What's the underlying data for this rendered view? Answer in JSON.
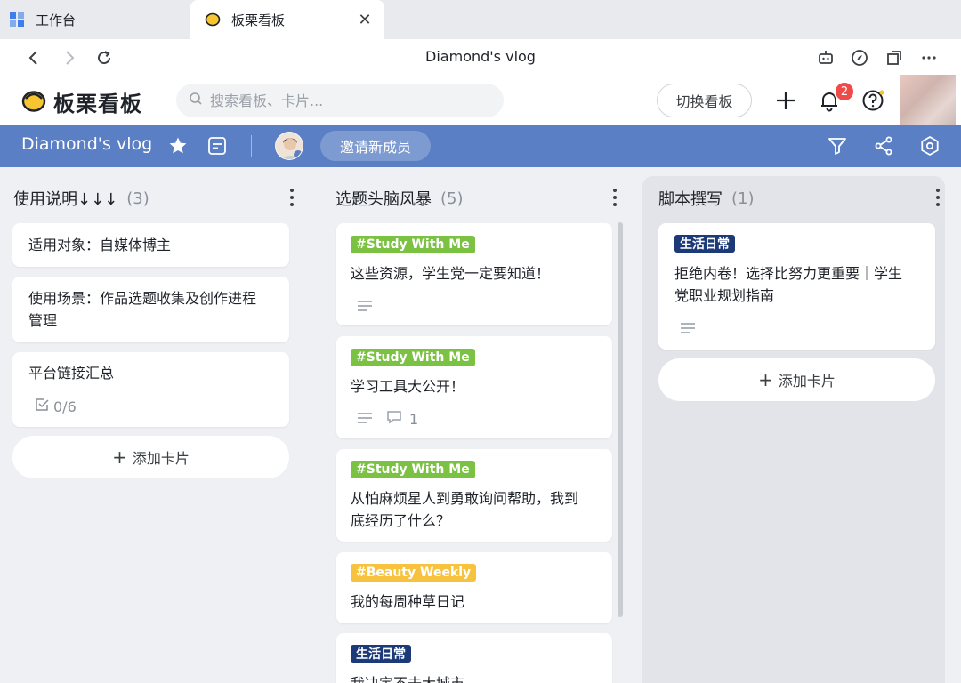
{
  "browser": {
    "tabs": [
      {
        "label": "工作台"
      },
      {
        "label": "板栗看板"
      }
    ],
    "page_title": "Diamond's vlog"
  },
  "header": {
    "app_name": "板栗看板",
    "search_placeholder": "搜索看板、卡片...",
    "switch_board_label": "切换看板",
    "notification_count": "2"
  },
  "board": {
    "title": "Diamond's vlog",
    "invite_label": "邀请新成员"
  },
  "columns": [
    {
      "title": "使用说明↓↓↓",
      "count": "(3)",
      "cards": [
        {
          "text": "适用对象：自媒体博主"
        },
        {
          "text_line1": "使用场景：作品选题收集及创作进程",
          "text_line2": "管理"
        },
        {
          "text": "平台链接汇总",
          "checklist": "0/6"
        }
      ],
      "add_label": "添加卡片"
    },
    {
      "title": "选题头脑风暴",
      "count": "(5)",
      "cards": [
        {
          "tag": "#Study With Me",
          "text": "这些资源，学生党一定要知道！"
        },
        {
          "tag": "#Study With Me",
          "text": "学习工具大公开！",
          "comments": "1"
        },
        {
          "tag": "#Study With Me",
          "text_line1": "从怕麻烦星人到勇敢询问帮助，我到",
          "text_line2": "底经历了什么？"
        },
        {
          "tag": "#Beauty Weekly",
          "text": "我的每周种草日记"
        },
        {
          "tag": "生活日常",
          "text": "我决定不去大城市"
        }
      ]
    },
    {
      "title": "脚本撰写",
      "count": "(1)",
      "cards": [
        {
          "tag": "生活日常",
          "text_line1": "拒绝内卷！选择比努力更重要｜学生",
          "text_line2": "党职业规划指南"
        }
      ],
      "add_label": "添加卡片"
    }
  ],
  "colors": {
    "board_bar": "#5a7fc4",
    "tag_green": "#7bc142",
    "tag_yellow": "#f7c33f",
    "tag_navy": "#1d3a78",
    "badge_red": "#f04a48"
  },
  "icons": [
    "grid-icon",
    "chestnut-logo-icon",
    "close-icon",
    "back-icon",
    "forward-icon",
    "reload-icon",
    "robot-icon",
    "compass-icon",
    "window-icon",
    "more-icon",
    "search-icon",
    "plus-icon",
    "bell-icon",
    "help-icon",
    "star-icon",
    "board-menu-icon",
    "filter-icon",
    "share-icon",
    "settings-icon",
    "checklist-icon",
    "description-icon",
    "comment-icon",
    "vertical-more-icon"
  ]
}
